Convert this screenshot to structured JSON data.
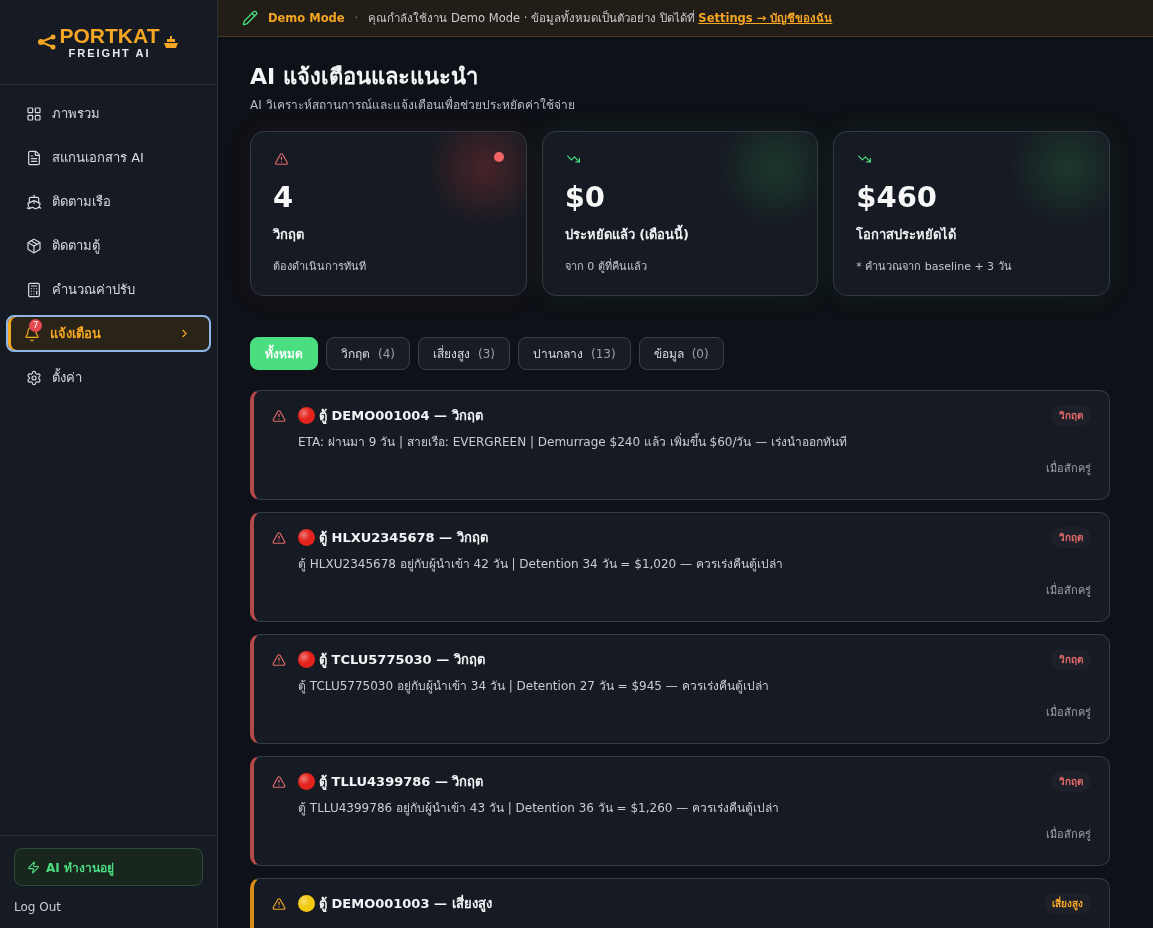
{
  "brand": {
    "name": "PORTKAT",
    "tagline": "FREIGHT AI"
  },
  "sidebar": {
    "items": [
      {
        "label": "ภาพรวม",
        "kind": "grid",
        "selected": false
      },
      {
        "label": "สแกนเอกสาร AI",
        "kind": "file",
        "selected": false
      },
      {
        "label": "ติดตามเรือ",
        "kind": "ship",
        "selected": false
      },
      {
        "label": "ติดตามตู้",
        "kind": "box",
        "selected": false
      },
      {
        "label": "คำนวณค่าปรับ",
        "kind": "calc",
        "selected": false
      },
      {
        "label": "แจ้งเตือน",
        "kind": "bell",
        "selected": true,
        "badge": "7"
      },
      {
        "label": "ตั้งค่า",
        "kind": "gear",
        "selected": false
      }
    ],
    "status": "AI ทำงานอยู่",
    "logout": "Log Out"
  },
  "banner": {
    "mode": "Demo Mode",
    "separator": "·",
    "text": "คุณกำลังใช้งาน Demo Mode · ข้อมูลทั้งหมดเป็นตัวอย่าง ปิดได้ที่",
    "link": "Settings → บัญชีของฉัน"
  },
  "page": {
    "title": "AI แจ้งเตือนและแนะนำ",
    "subtitle": "AI วิเคราะห์สถานการณ์และแจ้งเตือนเพื่อช่วยประหยัดค่าใช้จ่าย"
  },
  "stats": [
    {
      "kind": "critical",
      "value": "4",
      "label": "วิกฤต",
      "note": "ต้องดำเนินการทันที"
    },
    {
      "kind": "saving",
      "value": "$0",
      "label": "ประหยัดแล้ว (เดือนนี้)",
      "note": "จาก 0 ตู้ที่คืนแล้ว"
    },
    {
      "kind": "saving",
      "value": "$460",
      "label": "โอกาสประหยัดได้",
      "note": "* คำนวณจาก baseline + 3 วัน"
    }
  ],
  "filters": [
    {
      "label": "ทั้งหมด",
      "selected": true
    },
    {
      "label": "วิกฤต",
      "count": "(4)",
      "selected": false
    },
    {
      "label": "เสี่ยงสูง",
      "count": "(3)",
      "selected": false
    },
    {
      "label": "ปานกลาง",
      "count": "(13)",
      "selected": false
    },
    {
      "label": "ข้อมูล",
      "count": "(0)",
      "selected": false
    }
  ],
  "alerts": [
    {
      "kind": "critical",
      "title": "ตู้ DEMO001004 — วิกฤต",
      "badge": "วิกฤต",
      "detail": "ETA: ผ่านมา 9 วัน | สายเรือ: EVERGREEN | Demurrage $240 แล้ว เพิ่มขึ้น $60/วัน — เร่งนำออกทันที",
      "time": "เมื่อสักครู่"
    },
    {
      "kind": "critical",
      "title": "ตู้ HLXU2345678 — วิกฤต",
      "badge": "วิกฤต",
      "detail": "ตู้ HLXU2345678 อยู่กับผู้นำเข้า 42 วัน | Detention 34 วัน = $1,020 — ควรเร่งคืนตู้เปล่า",
      "time": "เมื่อสักครู่"
    },
    {
      "kind": "critical",
      "title": "ตู้ TCLU5775030 — วิกฤต",
      "badge": "วิกฤต",
      "detail": "ตู้ TCLU5775030 อยู่กับผู้นำเข้า 34 วัน | Detention 27 วัน = $945 — ควรเร่งคืนตู้เปล่า",
      "time": "เมื่อสักครู่"
    },
    {
      "kind": "critical",
      "title": "ตู้ TLLU4399786 — วิกฤต",
      "badge": "วิกฤต",
      "detail": "ตู้ TLLU4399786 อยู่กับผู้นำเข้า 43 วัน | Detention 36 วัน = $1,260 — ควรเร่งคืนตู้เปล่า",
      "time": "เมื่อสักครู่"
    },
    {
      "kind": "high",
      "title": "ตู้ DEMO001003 — เสี่ยงสูง",
      "badge": "เสี่ยงสูง"
    }
  ]
}
